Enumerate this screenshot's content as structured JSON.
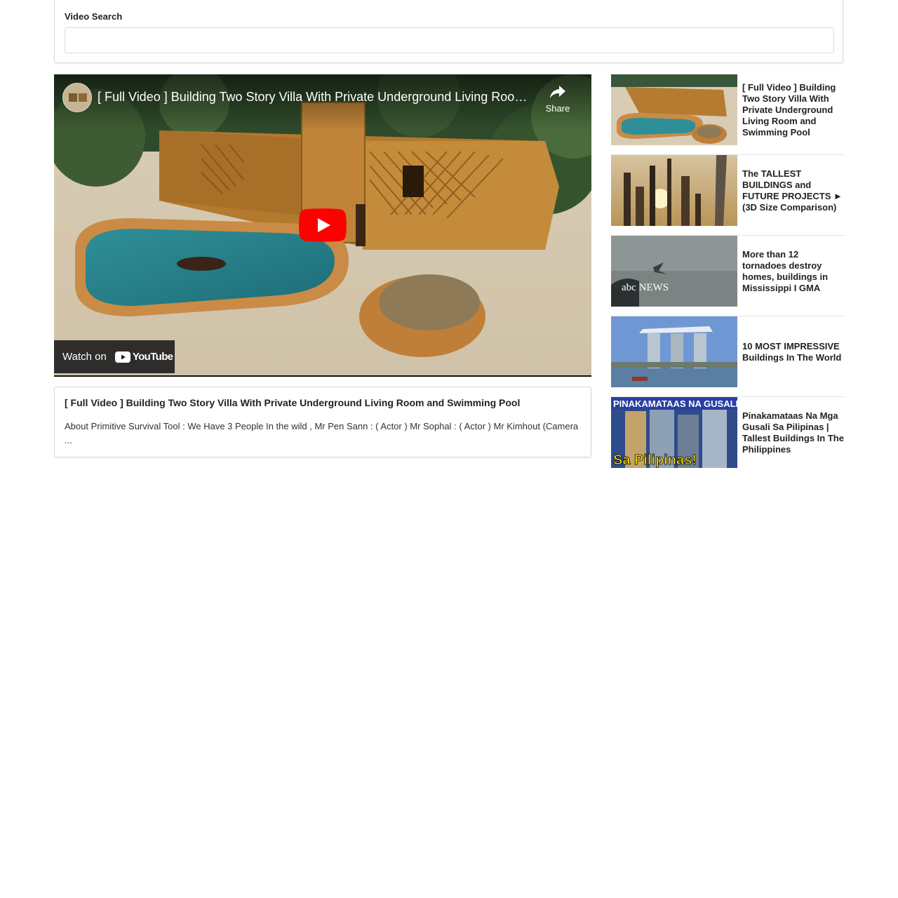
{
  "search": {
    "label": "Video Search",
    "value": "",
    "placeholder": ""
  },
  "player": {
    "title": "[ Full Video ] Building Two Story Villa With Private Underground Living Room a...",
    "share_label": "Share",
    "watch_on_label": "Watch on",
    "youtube_logo_text": "YouTube",
    "icons": [
      "channel-avatar",
      "share-icon",
      "play-icon",
      "youtube-icon"
    ]
  },
  "video_info": {
    "title": "[ Full Video ] Building Two Story Villa With Private Underground Living Room and Swimming Pool",
    "description": "About Primitive Survival Tool : We Have 3 People In the wild , Mr Pen Sann : ( Actor ) Mr Sophal : ( Actor ) Mr Kimhout (Camera ..."
  },
  "related": [
    {
      "title": "[ Full Video ] Building Two Story Villa With Private Underground Living Room and Swimming Pool",
      "thumb": "villa-pool"
    },
    {
      "title": "The TALLEST BUILDINGS and FUTURE PROJECTS ► (3D Size Comparison)",
      "thumb": "skyscrapers-sunset"
    },
    {
      "title": "More than 12 tornadoes destroy homes, buildings in Mississippi I GMA",
      "thumb": "abc-news-storm",
      "thumb_text": "abc NEWS"
    },
    {
      "title": "10 MOST IMPRESSIVE Buildings In The World",
      "thumb": "marina-bay-sands"
    },
    {
      "title": "Pinakamataas Na Mga Gusali Sa Pilipinas | Tallest Buildings In The Philippines",
      "thumb": "philippines-towers",
      "thumb_text_top": "PINAKAMATAAS NA GUSALI",
      "thumb_text_bottom": "Sa Pilipinas!"
    }
  ],
  "colors": {
    "youtube_red": "#ff0000",
    "text": "#222222",
    "border": "#d9d9d9"
  }
}
